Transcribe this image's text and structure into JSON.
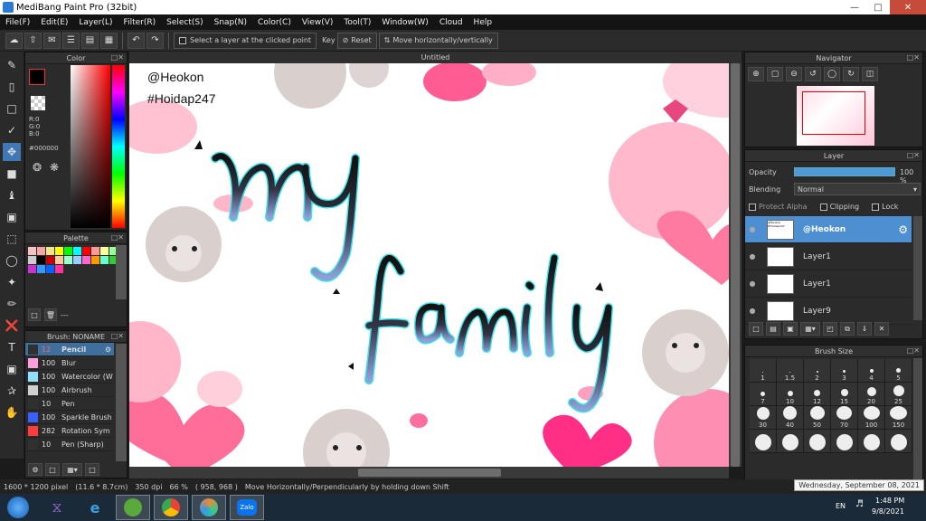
{
  "window": {
    "title": "MediBang Paint Pro (32bit)"
  },
  "menu": [
    "File(F)",
    "Edit(E)",
    "Layer(L)",
    "Filter(R)",
    "Select(S)",
    "Snap(N)",
    "Color(C)",
    "View(V)",
    "Tool(T)",
    "Window(W)",
    "Cloud",
    "Help"
  ],
  "toolbar": {
    "select_layer_label": "Select a layer at the clicked point",
    "key_label": "Key",
    "reset_label": "Reset",
    "move_label": "Move horizontally/vertically"
  },
  "color_panel": {
    "title": "Color",
    "r": "R:0",
    "g": "G:0",
    "b": "B:0",
    "hex": "#000000",
    "primary": "#000000"
  },
  "palette_panel": {
    "title": "Palette",
    "colors": [
      "#f9c0c0",
      "#f7a6a6",
      "#f0e68c",
      "#ffff00",
      "#00ff00",
      "#00ffff",
      "#ff0000",
      "#ff9999",
      "#ffff99",
      "#99ff99",
      "#cccccc",
      "#000000",
      "#cc0000",
      "#ffcc99",
      "#99ffcc",
      "#99ccff",
      "#ff66cc",
      "#ff9900",
      "#66ffcc",
      "#33cc33",
      "#cc33cc",
      "#3399ff",
      "#0066ff",
      "#ff3399"
    ],
    "footer_label": "---"
  },
  "brush_panel": {
    "title": "Brush: NONAME",
    "brushes": [
      {
        "size": "12",
        "name": "Pencil",
        "color": "#303030"
      },
      {
        "size": "100",
        "name": "Blur",
        "color": "#ff9ddf"
      },
      {
        "size": "100",
        "name": "Watercolor (W",
        "color": "#8fdfff"
      },
      {
        "size": "100",
        "name": "Airbrush",
        "color": "#d0d0d0"
      },
      {
        "size": "10",
        "name": "Pen",
        "color": "#303030"
      },
      {
        "size": "100",
        "name": "Sparkle Brush",
        "color": "#3a5fff"
      },
      {
        "size": "282",
        "name": "Rotation Sym",
        "color": "#ff3b3b"
      },
      {
        "size": "10",
        "name": "Pen (Sharp)",
        "color": "#303030"
      }
    ]
  },
  "canvas": {
    "tab_title": "Untitled",
    "text_handle": "@Heokon",
    "text_tag": "#Hoidap247",
    "text_my": "my",
    "text_family": "family"
  },
  "navigator": {
    "title": "Navigator"
  },
  "layer_panel": {
    "title": "Layer",
    "opacity_label": "Opacity",
    "opacity_value": "100 %",
    "blending_label": "Blending",
    "blending_value": "Normal",
    "protect_alpha": "Protect Alpha",
    "clipping": "Clipping",
    "lock": "Lock",
    "layers": [
      {
        "name": "@Heokon",
        "thumb_text": "@Heokon #Hoidap247"
      },
      {
        "name": "Layer1"
      },
      {
        "name": "Layer1"
      },
      {
        "name": "Layer9"
      }
    ]
  },
  "brush_size_panel": {
    "title": "Brush Size",
    "sizes": [
      "1",
      "1.5",
      "2",
      "3",
      "4",
      "5",
      "7",
      "10",
      "12",
      "15",
      "20",
      "25",
      "30",
      "40",
      "50",
      "70",
      "100",
      "150",
      "",
      "",
      "",
      "",
      "",
      ""
    ]
  },
  "status": {
    "dimensions": "1600 * 1200 pixel",
    "physical": "(11.6 * 8.7cm)",
    "dpi": "350 dpi",
    "zoom": "66 %",
    "coords": "( 958, 968 )",
    "hint": "Move Horizontally/Perpendicularly by holding down Shift",
    "date_tooltip": "Wednesday, September 08, 2021"
  },
  "taskbar": {
    "lang": "EN",
    "time": "1:48 PM",
    "date": "9/8/2021",
    "zalo": "Zalo"
  }
}
